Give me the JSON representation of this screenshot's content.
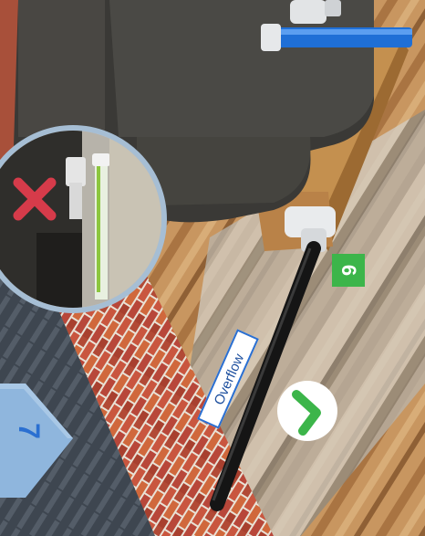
{
  "labels": {
    "overflow": "Overflow",
    "step_six": "6",
    "step_seven": "7"
  },
  "icons": {
    "correct": "check-circle-icon",
    "incorrect": "cross-icon"
  },
  "colors": {
    "label_border": "#2a6fd1",
    "label_text": "#1d4f9e",
    "step_badge": "#3cb54a",
    "tick_green": "#3cb54a",
    "cross_red": "#d63b4a",
    "arrow_badge": "#8fb6dd",
    "supply_pipe": "#1f6fd6"
  }
}
